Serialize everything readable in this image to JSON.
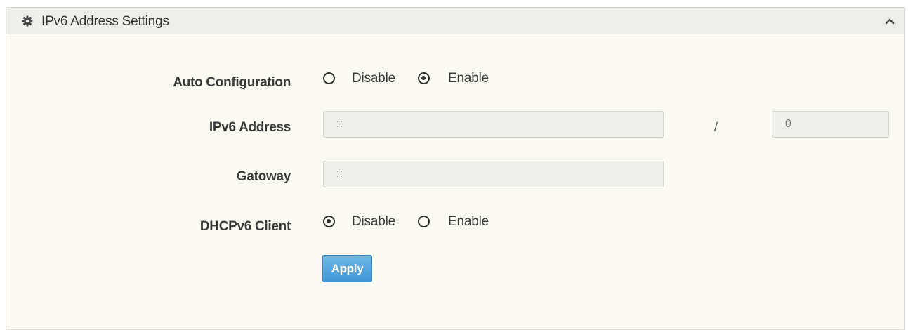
{
  "panel": {
    "title": "IPv6 Address Settings",
    "header_icon": "gear-icon",
    "collapse_icon": "chevron-up-icon"
  },
  "auto_configuration": {
    "label": "Auto Configuration",
    "options": [
      "Disable",
      "Enable"
    ],
    "selected": "Enable"
  },
  "ipv6_address": {
    "label": "IPv6 Address",
    "value": "::",
    "separator": "/",
    "prefix_length": "0"
  },
  "gateway": {
    "label": "Gatoway",
    "value": "::"
  },
  "dhcpv6_client": {
    "label": "DHCPv6 Client",
    "options": [
      "Disable",
      "Enable"
    ],
    "selected": "Disable"
  },
  "apply_button": {
    "label": "Apply",
    "color": "#4a9ede"
  }
}
